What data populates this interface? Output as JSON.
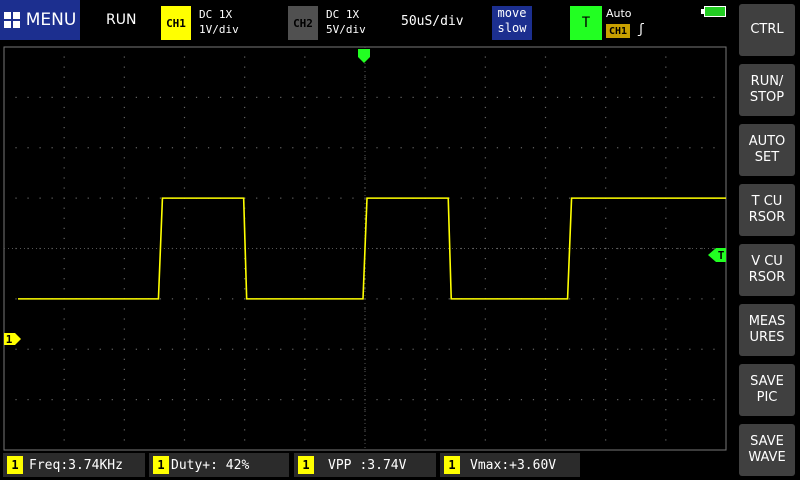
{
  "menu": {
    "label": "MENU"
  },
  "run_status": "RUN",
  "ch1": {
    "label": "CH1",
    "coupling": "DC  1X",
    "scale": "1V/div",
    "color": "#ffff00"
  },
  "ch2": {
    "label": "CH2",
    "coupling": "DC  1X",
    "scale": "5V/div",
    "color": "#505050"
  },
  "timebase": "50uS/div",
  "move_mode": {
    "line1": "move",
    "line2": "slow"
  },
  "trigger": {
    "badge": "T",
    "mode": "Auto",
    "source": "CH1",
    "edge": "ʃ",
    "marker": "T",
    "color": "#22ff22"
  },
  "ch1_marker": "1",
  "side_buttons": [
    "CTRL",
    "RUN/\nSTOP",
    "AUTO\nSET",
    "T CU\nRSOR",
    "V CU\nRSOR",
    "MEAS\nURES",
    "SAVE\nPIC",
    "SAVE\nWAVE"
  ],
  "measurements": [
    {
      "channel": "1",
      "name": "Freq",
      "value": ":3.74KHz"
    },
    {
      "channel": "1",
      "name": "Duty+",
      "value": ": 42%"
    },
    {
      "channel": "1",
      "name": "VPP",
      "value": ":3.74V"
    },
    {
      "channel": "1",
      "name": "Vmax",
      "value": ":+3.60V"
    }
  ],
  "waveform": {
    "high_level_div": 1.0,
    "low_level_div": -1.0,
    "rising_edges_div": [
      -3.4,
      0.0,
      3.4
    ],
    "falling_edges_div": [
      -2.0,
      1.4
    ],
    "color": "#ffff00"
  }
}
